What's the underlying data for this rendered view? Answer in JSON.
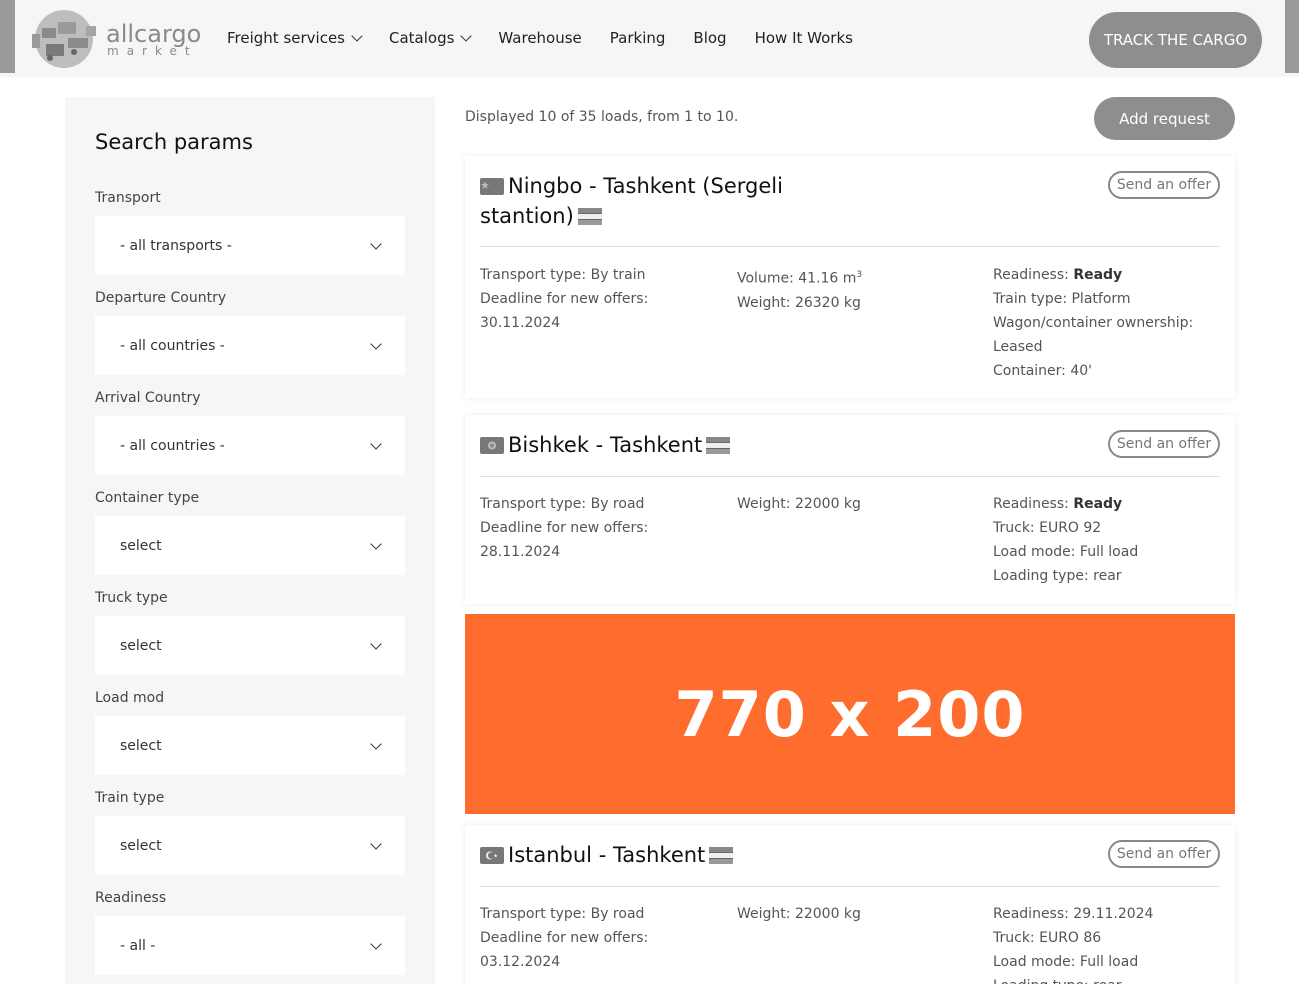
{
  "header": {
    "logo": {
      "word1": "allcargo",
      "word2": "market"
    },
    "nav": [
      {
        "label": "Freight services",
        "dropdown": true
      },
      {
        "label": "Catalogs",
        "dropdown": true
      },
      {
        "label": "Warehouse",
        "dropdown": false
      },
      {
        "label": "Parking",
        "dropdown": false
      },
      {
        "label": "Blog",
        "dropdown": false
      },
      {
        "label": "How It Works",
        "dropdown": false
      }
    ],
    "track_button": "TRACK THE CARGO"
  },
  "sidebar": {
    "title": "Search params",
    "filters": [
      {
        "label": "Transport",
        "value": "- all transports -"
      },
      {
        "label": "Departure Country",
        "value": "- all countries -"
      },
      {
        "label": "Arrival Country",
        "value": "- all countries -"
      },
      {
        "label": "Container type",
        "value": "select"
      },
      {
        "label": "Truck type",
        "value": "select"
      },
      {
        "label": "Load mod",
        "value": "select"
      },
      {
        "label": "Train type",
        "value": "select"
      },
      {
        "label": "Readiness",
        "value": "- all -"
      }
    ]
  },
  "main": {
    "summary": "Displayed 10 of 35 loads, from 1 to 10.",
    "add_request": "Add request",
    "ad_text": "770 x 200",
    "cards": [
      {
        "title": "Ningbo - Tashkent (Sergeli stantion)",
        "offer": "Send an offer",
        "transport_type": "Transport type: By train",
        "deadline_label": "Deadline for new offers:",
        "deadline": "30.11.2024",
        "volume": "Volume: 41.16 m",
        "volume_sup": "3",
        "weight": "Weight: 26320 kg",
        "readiness_label": "Readiness: ",
        "readiness": "Ready",
        "details": [
          "Train type: Platform",
          "Wagon/container ownership:",
          "Leased",
          "Container: 40'"
        ]
      },
      {
        "title": "Bishkek - Tashkent",
        "offer": "Send an offer",
        "transport_type": "Transport type: By road",
        "deadline_label": "Deadline for new offers:",
        "deadline": "28.11.2024",
        "weight": "Weight: 22000 kg",
        "readiness_label": "Readiness: ",
        "readiness": "Ready",
        "details": [
          "Truck: EURO 92",
          "Load mode: Full load",
          "Loading type: rear"
        ]
      },
      {
        "title": "Istanbul - Tashkent",
        "offer": "Send an offer",
        "transport_type": "Transport type: By road",
        "deadline_label": "Deadline for new offers:",
        "deadline": "03.12.2024",
        "weight": "Weight: 22000 kg",
        "readiness_label": "Readiness: 29.11.2024",
        "details": [
          "Truck: EURO 86",
          "Load mode: Full load",
          "Loading type: rear"
        ]
      }
    ]
  },
  "colors": {
    "accent_gray": "#8e8e8e",
    "ad_orange": "#ff6d2e",
    "panel_bg": "#f6f6f6"
  }
}
